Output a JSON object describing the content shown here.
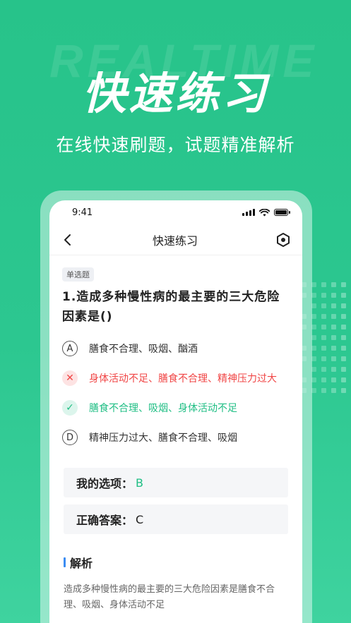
{
  "hero": {
    "bg_word": "REALTIME",
    "title": "快速练习",
    "subtitle": "在线快速刷题，试题精准解析"
  },
  "status_bar": {
    "time": "9:41"
  },
  "navbar": {
    "back_icon": "chevron-left-icon",
    "title": "快速练习",
    "settings_icon": "hexagon-settings-icon"
  },
  "question": {
    "type": "单选题",
    "text": "1.造成多种慢性病的最主要的三大危险因素是()",
    "options": [
      {
        "key": "A",
        "text": "膳食不合理、吸烟、酗酒",
        "state": "normal"
      },
      {
        "key": "B",
        "text": "身体活动不足、膳食不合理、精神压力过大",
        "state": "wrong",
        "icon": "✕"
      },
      {
        "key": "C",
        "text": "膳食不合理、吸烟、身体活动不足",
        "state": "correct",
        "icon": "✓"
      },
      {
        "key": "D",
        "text": "精神压力过大、膳食不合理、吸烟",
        "state": "normal"
      }
    ]
  },
  "answers": {
    "mine_label": "我的选项：",
    "mine_value": "B",
    "correct_label": "正确答案：",
    "correct_value": "C"
  },
  "analysis": {
    "heading": "解析",
    "text": "造成多种慢性病的最主要的三大危险因素是膳食不合理、吸烟、身体活动不足"
  },
  "colors": {
    "brand_green": "#27c38a",
    "correct_green": "#1fbe84",
    "wrong_red": "#f04545",
    "accent_blue": "#3b8cf2"
  }
}
